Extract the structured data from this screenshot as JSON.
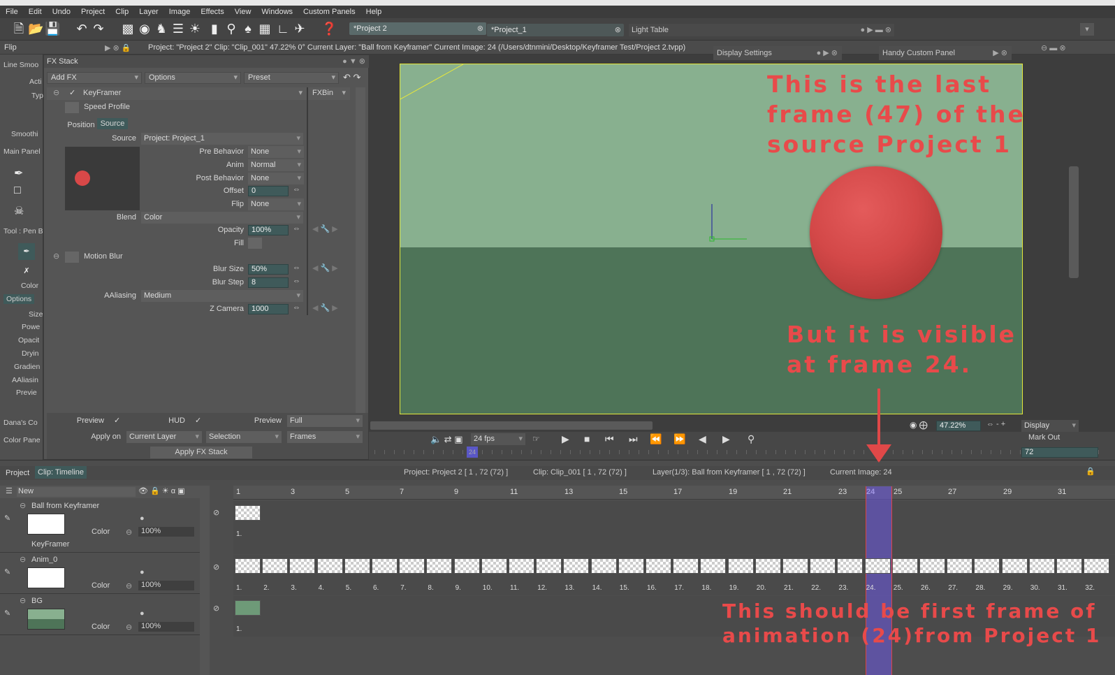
{
  "menu": [
    "File",
    "Edit",
    "Undo",
    "Project",
    "Clip",
    "Layer",
    "Image",
    "Effects",
    "View",
    "Windows",
    "Custom Panels",
    "Help"
  ],
  "tabs": [
    {
      "label": "*Project 2"
    },
    {
      "label": "*Project_1"
    }
  ],
  "light_table": "Light Table",
  "info": {
    "flip": "Flip",
    "status": "Project:  \"Project 2\"  Clip: \"Clip_001\"   47.22%   0°  Current Layer: \"Ball from Keyframer\"  Current Image: 24 (/Users/dtnmini/Desktop/Keyframer Test/Project 2.tvpp)"
  },
  "left_panel": {
    "items": [
      "Line Smoo",
      "Acti",
      "Typ",
      "Smoothi",
      "Main Panel",
      "Tool : Pen B",
      "Color",
      "Options",
      "Size",
      "Powe",
      "Opacit",
      "Dryin",
      "Gradien",
      "AAliasin",
      "Previe",
      "Dana's Co",
      "Color Pane"
    ]
  },
  "fx": {
    "title": "FX Stack",
    "add_fx": "Add FX",
    "options": "Options",
    "preset": "Preset",
    "keyframer": "KeyFramer",
    "fxbin": "FXBin",
    "speed_profile": "Speed Profile",
    "tab_position": "Position",
    "tab_source": "Source",
    "source_label": "Source",
    "source_value": "Project: Project_1",
    "pre_behavior_label": "Pre Behavior",
    "pre_behavior": "None",
    "anim_label": "Anim",
    "anim": "Normal",
    "post_behavior_label": "Post Behavior",
    "post_behavior": "None",
    "offset_label": "Offset",
    "offset": "0",
    "flip_label": "Flip",
    "flip": "None",
    "blend_label": "Blend",
    "blend": "Color",
    "opacity_label": "Opacity",
    "opacity": "100%",
    "fill_label": "Fill",
    "motion_blur": "Motion Blur",
    "blur_size_label": "Blur Size",
    "blur_size": "50%",
    "blur_step_label": "Blur Step",
    "blur_step": "8",
    "aaliasing_label": "AAliasing",
    "aaliasing": "Medium",
    "zcamera_label": "Z Camera",
    "zcamera": "1000",
    "preview_label": "Preview",
    "hud_label": "HUD",
    "preview2_label": "Preview",
    "preview2": "Full",
    "apply_on_label": "Apply on",
    "apply_on": "Current Layer",
    "selection": "Selection",
    "frames": "Frames",
    "apply_btn": "Apply FX Stack"
  },
  "panels": {
    "display_settings": "Display Settings",
    "handy": "Handy Custom Panel"
  },
  "annotations": {
    "top": [
      "This is the last",
      "frame (47) of the",
      "source Project 1"
    ],
    "mid": [
      "But it is visible",
      "at frame 24."
    ],
    "bottom": [
      "This should be first frame of",
      "animation (24)from Project 1"
    ]
  },
  "playback": {
    "fps": "24 fps",
    "zoom": "47.22%",
    "display": "Display",
    "mark_out": "Mark Out",
    "end_frame": "72",
    "current_marker": "24"
  },
  "timeline": {
    "tab_project": "Project",
    "tab_clip": "Clip: Timeline",
    "project_info": "Project: Project 2 [ 1 , 72  (72) ]",
    "clip_info": "Clip: Clip_001 [ 1 , 72  (72) ]",
    "layer_info": "Layer(1/3): Ball from Keyframer [ 1 , 72  (72) ]",
    "current_image": "Current Image: 24",
    "new_label": "New",
    "ruler": [
      "1",
      "3",
      "5",
      "7",
      "9",
      "11",
      "13",
      "15",
      "17",
      "19",
      "21",
      "23",
      "24",
      "25",
      "27",
      "29",
      "31"
    ],
    "layers": [
      {
        "name": "Ball from Keyframer",
        "color_label": "Color",
        "opacity": "100%",
        "sub": "KeyFramer",
        "cell_label": "1."
      },
      {
        "name": "Anim_0",
        "color_label": "Color",
        "opacity": "100%"
      },
      {
        "name": "BG",
        "color_label": "Color",
        "opacity": "100%",
        "cell_label": "1."
      }
    ],
    "anim_cells": [
      "1.",
      "2.",
      "3.",
      "4.",
      "5.",
      "6.",
      "7.",
      "8.",
      "9.",
      "10.",
      "11.",
      "12.",
      "13.",
      "14.",
      "15.",
      "16.",
      "17.",
      "18.",
      "19.",
      "20.",
      "21.",
      "22.",
      "23.",
      "24.",
      "25.",
      "26.",
      "27.",
      "28.",
      "29.",
      "30.",
      "31.",
      "32."
    ]
  }
}
